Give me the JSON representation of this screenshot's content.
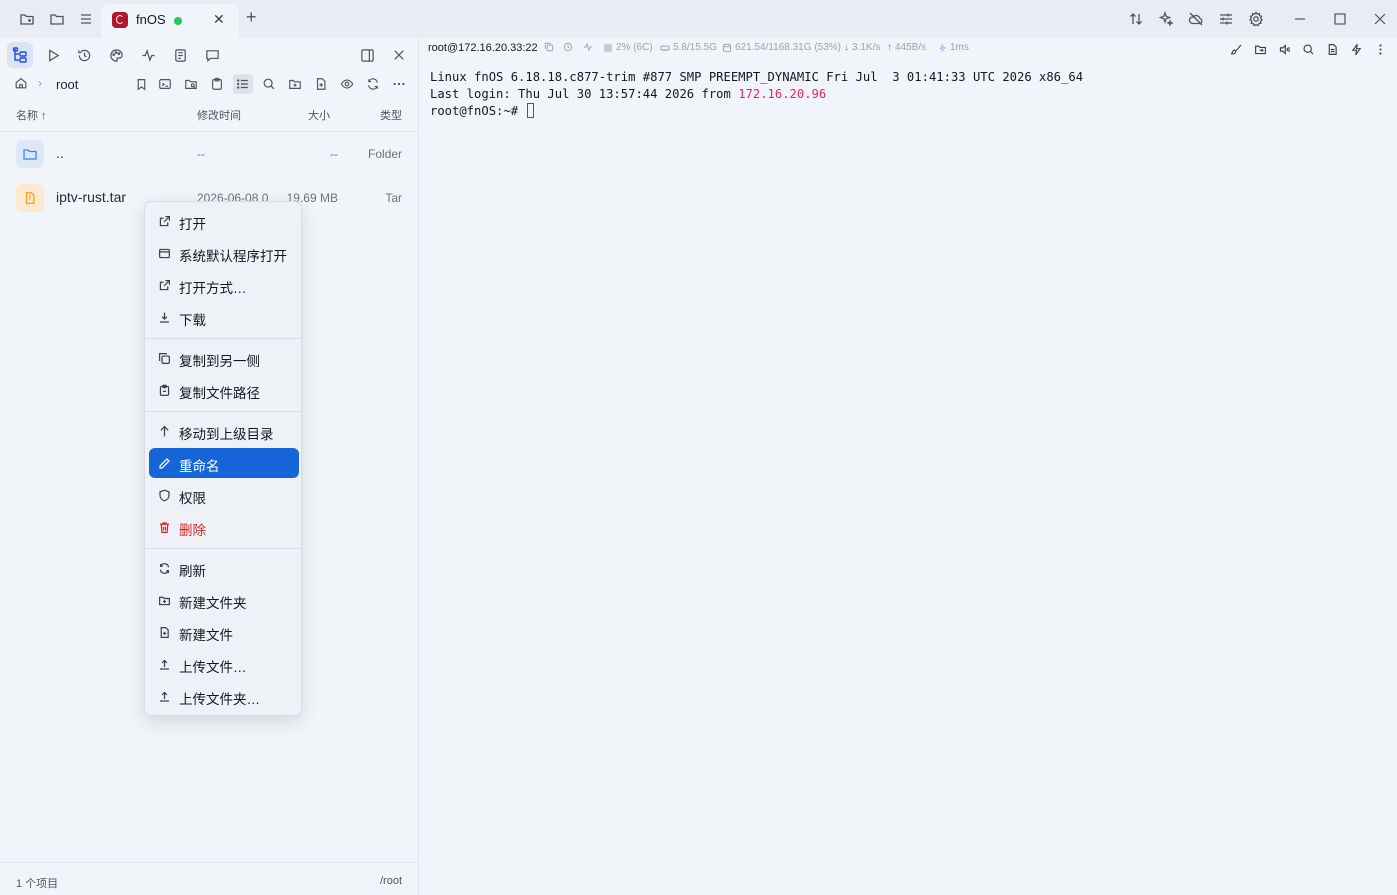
{
  "titlebar": {
    "left_icons": [
      "folder-add-icon",
      "folder-icon",
      "menu-icon"
    ],
    "tab": {
      "title": "fnOS",
      "status": "connected",
      "logo": "debian-logo-icon"
    },
    "right_icons": [
      "transfer-icon",
      "ai-sparkle-icon",
      "cloud-off-icon",
      "sliders-icon",
      "gear-icon"
    ],
    "window_controls": [
      "minimize",
      "maximize",
      "close"
    ]
  },
  "left_panel": {
    "toolbar_icons": [
      "file-tree-icon",
      "play-icon",
      "history-icon",
      "palette-icon",
      "activity-icon",
      "notes-icon",
      "chat-icon"
    ],
    "breadcrumb": {
      "root": "root"
    },
    "columns": {
      "name": "名称 ↑",
      "modified": "修改时间",
      "size": "大小",
      "type": "类型"
    },
    "files": [
      {
        "name": "..",
        "modified": "--",
        "size": "--",
        "type": "Folder"
      },
      {
        "name": "iptv-rust.tar",
        "modified": "2026-06-08 0",
        "size": "19.69 MB",
        "type": "Tar"
      }
    ],
    "status": {
      "count": "1 个项目",
      "path": "/root"
    }
  },
  "terminal": {
    "host": "root@172.16.20.33:22",
    "stats": {
      "cpu": "2% (6C)",
      "mem": "5.8/15.5G",
      "disk": "621.54/1168.31G (53%)",
      "down": "3.1K/s",
      "up": "445B/s",
      "latency": "1ms"
    },
    "lines": {
      "line1": "Linux fnOS 6.18.18.c877-trim #877 SMP PREEMPT_DYNAMIC Fri Jul  3 01:41:33 UTC 2026 x86_64",
      "line2_prefix": "Last login: Thu Jul 30 13:57:44 2026 from ",
      "line2_ip": "172.16.20.96",
      "prompt": "root@fnOS:~# "
    }
  },
  "context_menu": {
    "items": [
      {
        "label": "打开",
        "icon": "external-link-icon"
      },
      {
        "label": "系统默认程序打开",
        "icon": "window-icon"
      },
      {
        "label": "打开方式…",
        "icon": "external-link-icon"
      },
      {
        "label": "下载",
        "icon": "download-icon"
      },
      {
        "label": "复制到另一侧",
        "icon": "copy-icon"
      },
      {
        "label": "复制文件路径",
        "icon": "clipboard-icon"
      },
      {
        "label": "移动到上级目录",
        "icon": "arrow-up-icon"
      },
      {
        "label": "重命名",
        "icon": "pencil-icon",
        "highlighted": true
      },
      {
        "label": "权限",
        "icon": "shield-icon"
      },
      {
        "label": "删除",
        "icon": "trash-icon",
        "danger": true
      },
      {
        "label": "刷新",
        "icon": "refresh-icon"
      },
      {
        "label": "新建文件夹",
        "icon": "folder-plus-icon"
      },
      {
        "label": "新建文件",
        "icon": "file-plus-icon"
      },
      {
        "label": "上传文件…",
        "icon": "upload-icon"
      },
      {
        "label": "上传文件夹…",
        "icon": "upload-icon"
      }
    ]
  },
  "colors": {
    "accent": "#1565d8",
    "danger": "#dc2626",
    "tab_logo": "#b3152d",
    "status_dot": "#22c55e",
    "terminal_ip": "#db2777"
  }
}
